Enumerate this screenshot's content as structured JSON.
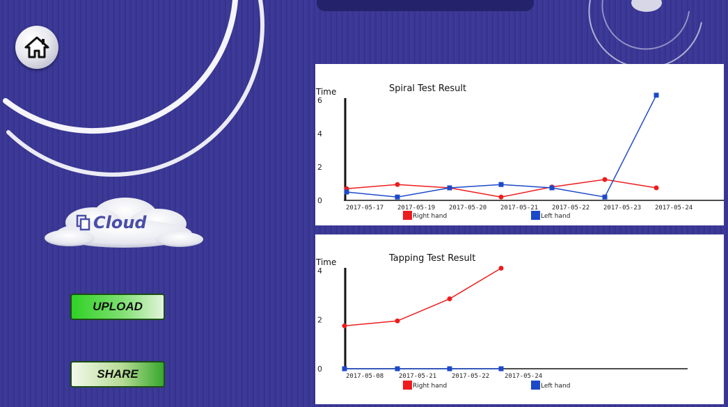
{
  "colors": {
    "background": "#3b3896",
    "right_hand": "#ee1c1c",
    "left_hand": "#1c49c8",
    "upload_green": "#2fd125",
    "share_green": "#36a82c"
  },
  "icons": {
    "home": "home-icon",
    "cloud": "cloud-icon",
    "copy": "copy-icon"
  },
  "cloud": {
    "label": "Cloud"
  },
  "buttons": {
    "upload": "UPLOAD",
    "share": "SHARE"
  },
  "chart_data": [
    {
      "type": "line",
      "title": "Spiral Test Result",
      "ylabel": "Time",
      "xlabel": "",
      "ylim": [
        0,
        6
      ],
      "yticks": [
        "0",
        "2",
        "4",
        "6"
      ],
      "categories": [
        "2017-05-17",
        "2017-05-19",
        "2017-05-20",
        "2017-05-21",
        "2017-05-22",
        "2017-05-23",
        "2017-05-24"
      ],
      "point_dates": [
        "2017-05-17",
        "2017-05-17",
        "2017-05-19",
        "2017-05-20",
        "2017-05-21",
        "2017-05-22",
        "2017-05-23",
        "2017-05-24"
      ],
      "legend_position": "bottom",
      "series": [
        {
          "name": "Right hand",
          "color": "#ee1c1c",
          "values": [
            0.7,
            0.95,
            0.75,
            0.2,
            0.8,
            1.25,
            0.75
          ]
        },
        {
          "name": "Left hand",
          "color": "#1c49c8",
          "values": [
            0.5,
            0.2,
            0.75,
            0.95,
            0.75,
            0.2,
            6.3
          ]
        }
      ]
    },
    {
      "type": "line",
      "title": "Tapping Test Result",
      "ylabel": "Time",
      "xlabel": "",
      "ylim": [
        0,
        4
      ],
      "yticks": [
        "0",
        "2",
        "4"
      ],
      "categories": [
        "2017-05-08",
        "2017-05-21",
        "2017-05-22",
        "2017-05-24"
      ],
      "point_dates": [
        "2017-05-08",
        "2017-05-21",
        "2017-05-22",
        "2017-05-24"
      ],
      "legend_position": "bottom",
      "series": [
        {
          "name": "Right hand",
          "color": "#ee1c1c",
          "values": [
            1.75,
            1.95,
            2.85,
            4.1
          ]
        },
        {
          "name": "Left hand",
          "color": "#1c49c8",
          "values": [
            0,
            0,
            0,
            0
          ]
        }
      ]
    }
  ]
}
